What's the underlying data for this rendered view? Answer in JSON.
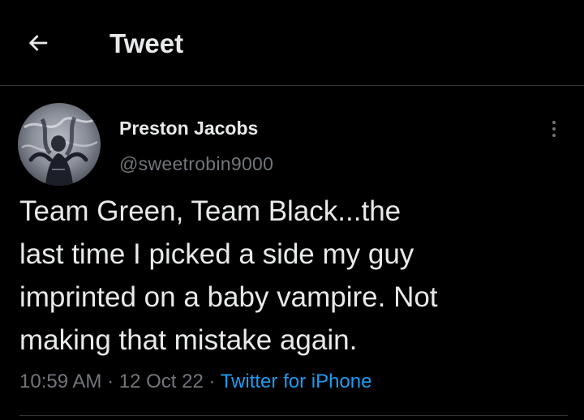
{
  "header": {
    "title": "Tweet",
    "back_icon": "back-arrow-icon"
  },
  "author": {
    "name": "Preston Jacobs",
    "handle": "@sweetrobin9000",
    "avatar": "avatar-image"
  },
  "tweet": {
    "text": "Team Green, Team Black...the\nlast time I picked a side my guy\nimprinted on a baby vampire. Not\nmaking that mistake again.",
    "time": "10:59 AM",
    "date": "12 Oct 22",
    "separator": "·",
    "source": "Twitter for iPhone"
  },
  "more_menu_icon": "more-vertical-icon",
  "colors": {
    "background": "#000000",
    "primary_text": "#e7e9ea",
    "secondary_text": "#71767b",
    "link": "#1d9bf0",
    "divider": "#2f3336"
  }
}
